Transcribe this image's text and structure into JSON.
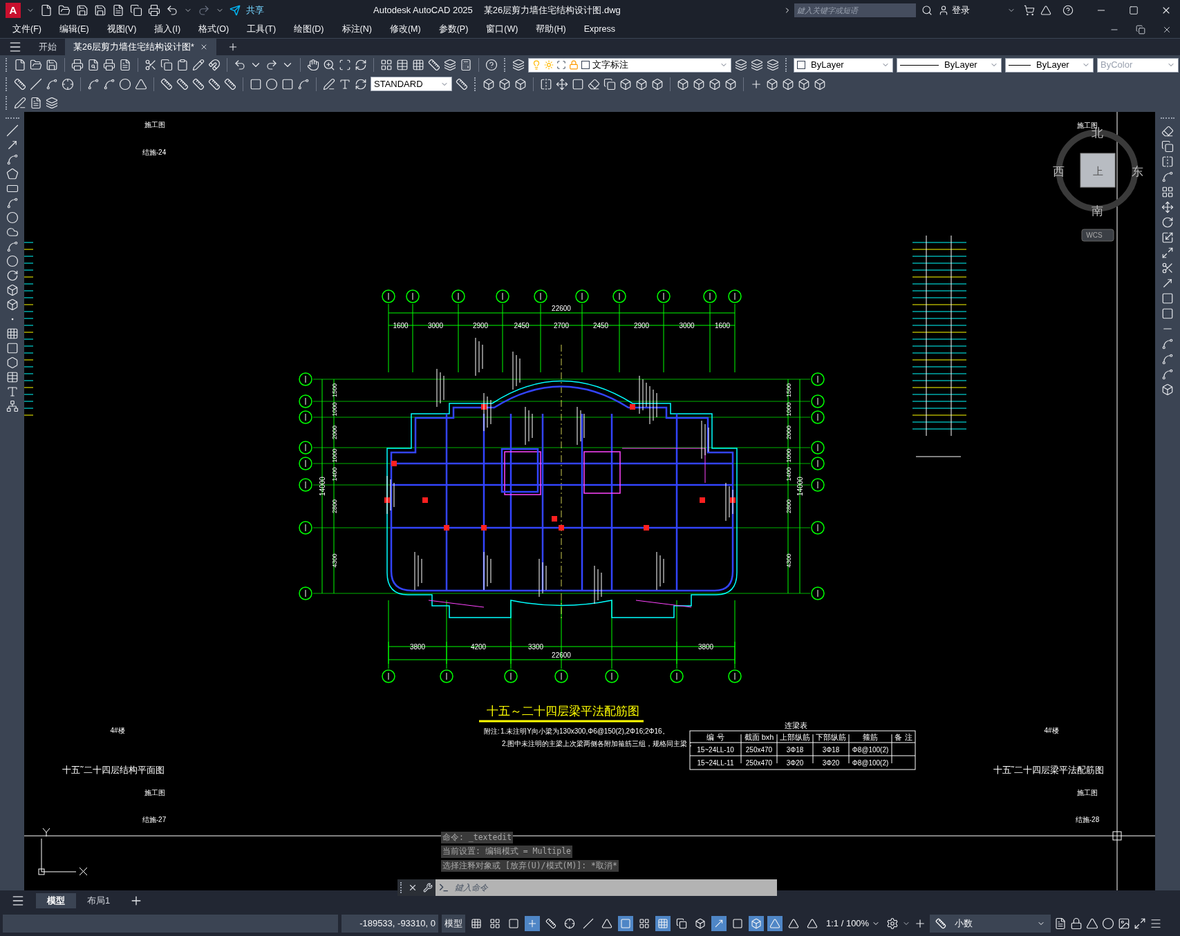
{
  "title_bar": {
    "logo": "A",
    "share": "共享",
    "app_title": "Autodesk AutoCAD 2025",
    "file_name": "某26层剪力墙住宅结构设计图.dwg",
    "search": {
      "placeholder": "鍵入关键字或短语"
    },
    "sign_in": "登录"
  },
  "menu": [
    "文件(F)",
    "编辑(E)",
    "视图(V)",
    "插入(I)",
    "格式(O)",
    "工具(T)",
    "绘图(D)",
    "标注(N)",
    "修改(M)",
    "参数(P)",
    "窗口(W)",
    "帮助(H)",
    "Express"
  ],
  "doc_tabs": [
    {
      "label": "开始",
      "selected": false
    },
    {
      "label": "某26层剪力墙住宅结构设计图*",
      "selected": true
    }
  ],
  "toolbar": {
    "layer": "文字标注",
    "color_control": "ByLayer",
    "linetype": "ByLayer",
    "lineweight": "ByLayer",
    "plot_style": "ByColor",
    "text_style": "STANDARD"
  },
  "left_sheet": {
    "status_top": "施工图",
    "sheet_no_top": "结施-24",
    "building": "4#楼",
    "title": "十五˜二十四层结构平面图",
    "status_bottom": "施工图",
    "sheet_no_bottom": "结施-27"
  },
  "right_sheet": {
    "status_top": "施工图",
    "building": "4#楼",
    "title": "十五˜二十四层梁平法配筋图",
    "status_bottom": "施工图",
    "sheet_no_bottom": "结施-28"
  },
  "plan": {
    "top_total": "22600",
    "top_dims": [
      "1600",
      "3000",
      "2900",
      "2450",
      "2700",
      "2450",
      "2900",
      "3000",
      "1600"
    ],
    "bottom_dims": [
      "3800",
      "4200",
      "3300",
      "3800"
    ],
    "bottom_total": "22600",
    "left_dims": [
      "1500",
      "1000",
      "2000",
      "1000",
      "1400",
      "2800",
      "4300"
    ],
    "left_total": "14000",
    "right_dims": [
      "1500",
      "1000",
      "2000",
      "1000",
      "1400",
      "2800",
      "4300"
    ],
    "right_total": "14000",
    "title": "十五～二十四层梁平法配筋图",
    "notes_label": "附注:",
    "notes": [
      "1.未注明Y向小梁为130x300,Φ6@150(2),2Φ16;2Φ16。",
      "2.图中未注明的主梁上次梁两侧各附加箍筋三组，规格同主梁；"
    ]
  },
  "beam_table": {
    "title": "连梁表",
    "columns": [
      "编 号",
      "截面 bxh",
      "上部纵筋",
      "下部纵筋",
      "箍筋",
      "备 注"
    ],
    "rows": [
      [
        "15~24LL-10",
        "250x470",
        "3Φ18",
        "3Φ18",
        "Φ8@100(2)"
      ],
      [
        "15~24LL-11",
        "250x470",
        "3Φ20",
        "3Φ20",
        "Φ8@100(2)"
      ]
    ]
  },
  "viewcube": {
    "north": "北",
    "south": "南",
    "west": "西",
    "east": "东",
    "face": "上",
    "wcs": "WCS"
  },
  "command_line": {
    "history": [
      "命令: _textedit",
      "当前设置: 编辑模式 = Multiple",
      "选择注释对象或 [放弃(U)/模式(M)]: *取消*"
    ],
    "placeholder": "鍵入命令"
  },
  "layout_tabs": [
    {
      "label": "模型",
      "selected": true
    },
    {
      "label": "布局1",
      "selected": false
    }
  ],
  "status_bar": {
    "coordinates": "-189533, -93310, 0",
    "space": "模型",
    "toggles": [
      {
        "on": false
      },
      {
        "on": false
      },
      {
        "on": false
      },
      {
        "on": true
      },
      {
        "on": false
      },
      {
        "on": false
      },
      {
        "on": false
      },
      {
        "on": false
      },
      {
        "on": true
      },
      {
        "on": false
      },
      {
        "on": true
      },
      {
        "on": false
      },
      {
        "on": false
      },
      {
        "on": true
      },
      {
        "on": false
      },
      {
        "on": true
      },
      {
        "on": true
      },
      {
        "on": false
      },
      {
        "on": false
      }
    ],
    "scale": "1:1 / 100%",
    "units": "小数"
  }
}
